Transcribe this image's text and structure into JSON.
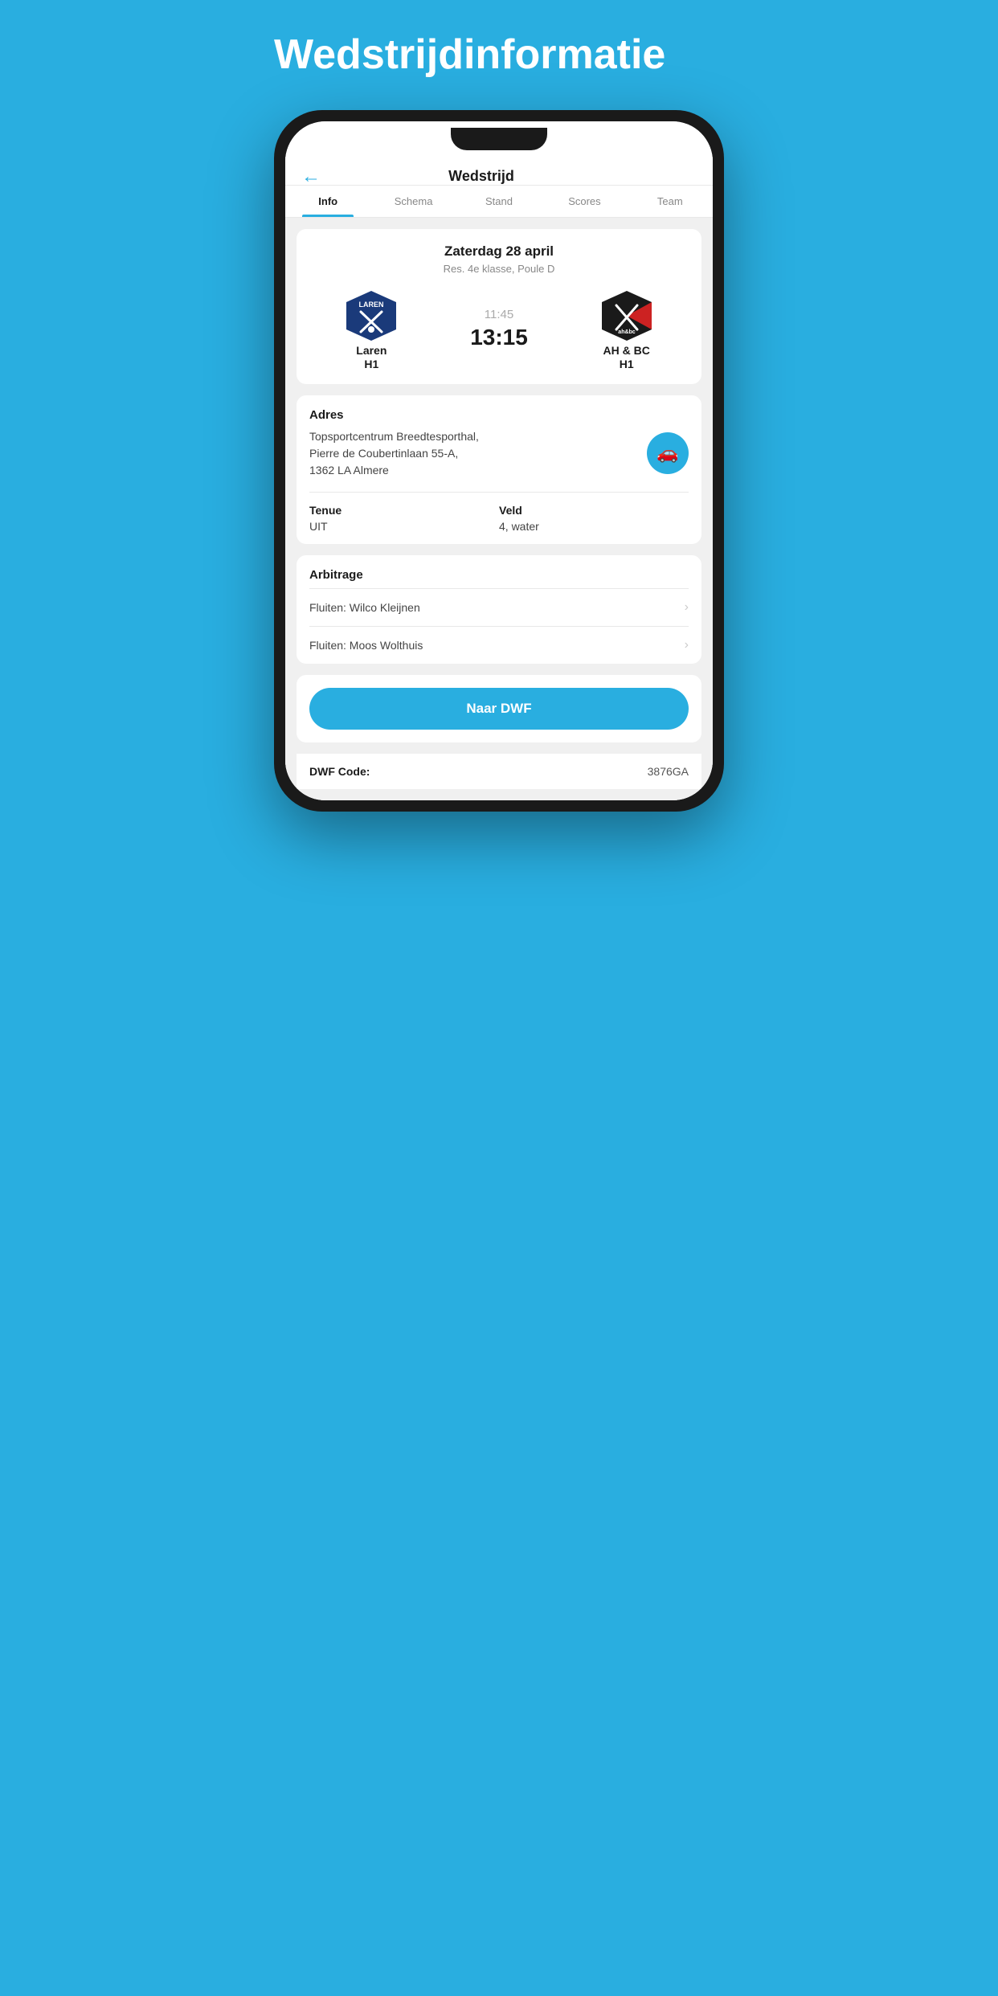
{
  "page": {
    "background_title": "Wedstrijdinformatie",
    "header": {
      "back_icon": "←",
      "title": "Wedstrijd"
    },
    "tabs": [
      {
        "id": "info",
        "label": "Info",
        "active": true
      },
      {
        "id": "schema",
        "label": "Schema",
        "active": false
      },
      {
        "id": "stand",
        "label": "Stand",
        "active": false
      },
      {
        "id": "scores",
        "label": "Scores",
        "active": false
      },
      {
        "id": "team",
        "label": "Team",
        "active": false
      }
    ],
    "match": {
      "date": "Zaterdag 28 april",
      "league": "Res. 4e klasse, Poule D",
      "home_team": "Laren",
      "home_team_sub": "H1",
      "away_team": "AH & BC",
      "away_team_sub": "H1",
      "time_scheduled": "11:45",
      "time_actual": "13:15"
    },
    "info": {
      "address_label": "Adres",
      "address_text": "Topsportcentrum Breedtesporthal,\nPierre de Coubertinlaan 55-A,\n1362 LA Almere",
      "tenue_label": "Tenue",
      "tenue_value": "UIT",
      "veld_label": "Veld",
      "veld_value": "4, water"
    },
    "arbitrage": {
      "label": "Arbitrage",
      "items": [
        {
          "text": "Fluiten: Wilco Kleijnen"
        },
        {
          "text": "Fluiten: Moos Wolthuis"
        }
      ]
    },
    "dwf": {
      "button_label": "Naar DWF",
      "code_label": "DWF Code:",
      "code_value": "3876GA"
    },
    "colors": {
      "primary": "#29aee0",
      "text_dark": "#1a1a1a",
      "text_mid": "#888888",
      "text_light": "#444444"
    }
  }
}
